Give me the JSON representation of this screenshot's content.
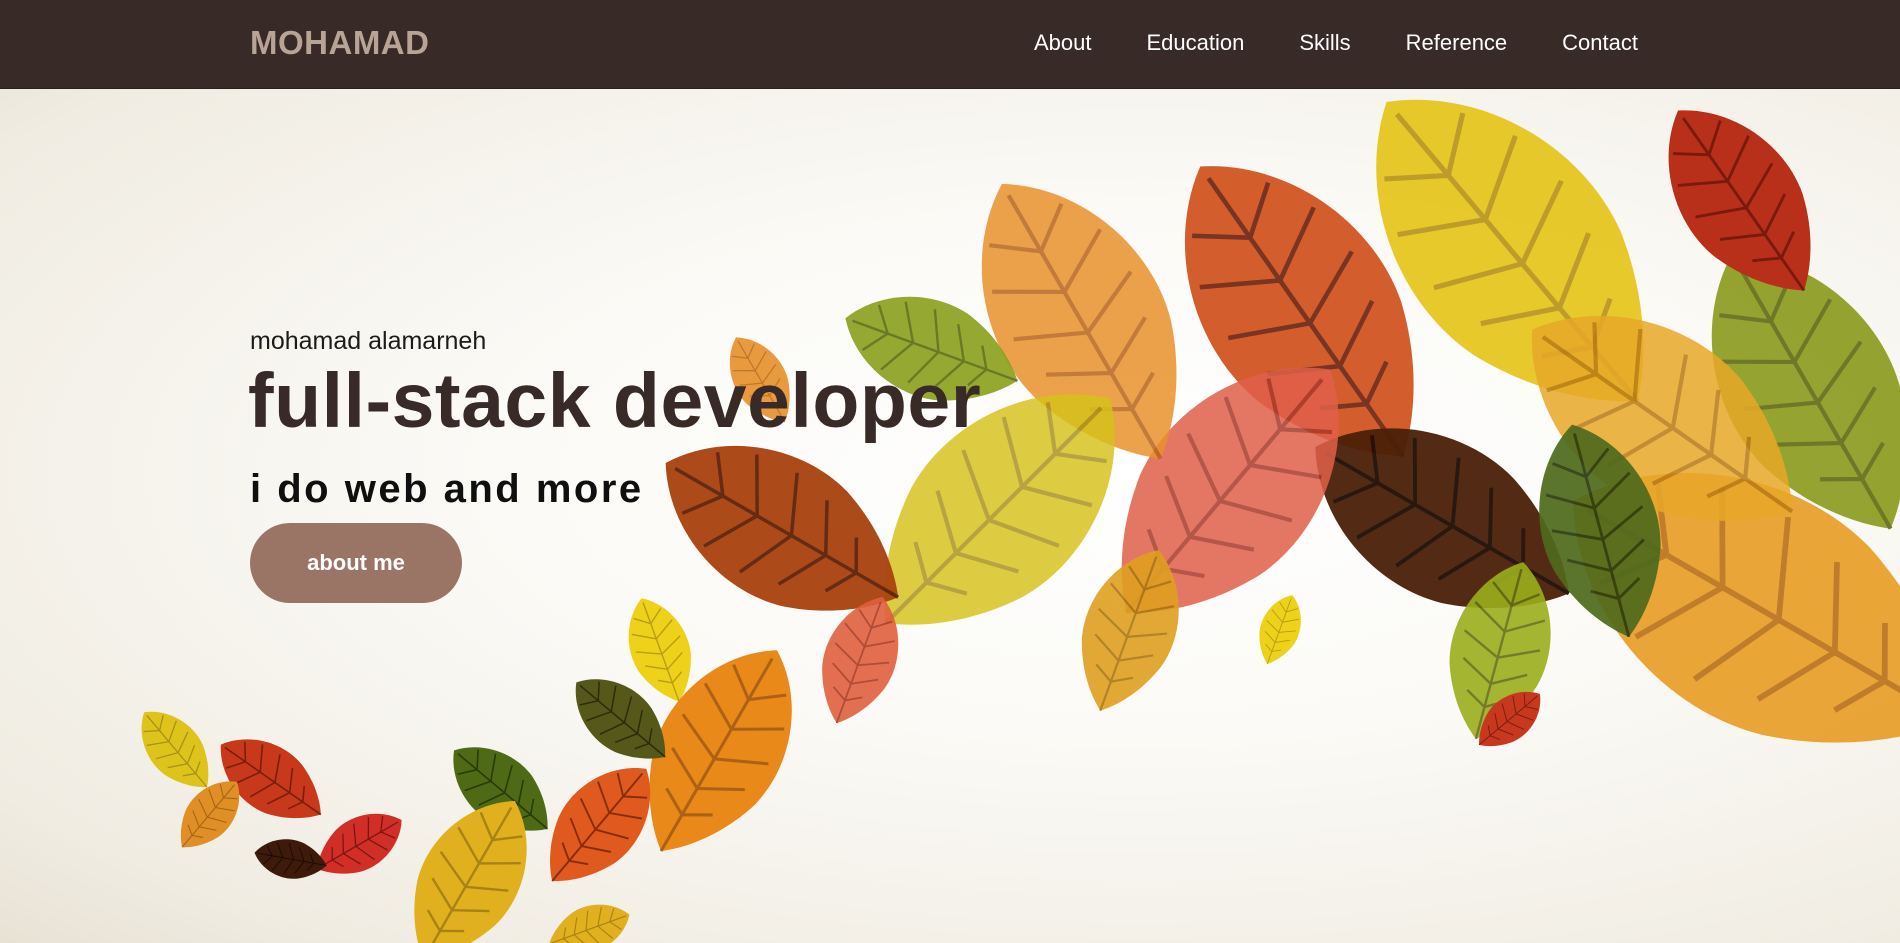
{
  "nav": {
    "brand": "MOHAMAD",
    "links": [
      {
        "label": "About"
      },
      {
        "label": "Education"
      },
      {
        "label": "Skills"
      },
      {
        "label": "Reference"
      },
      {
        "label": "Contact"
      }
    ]
  },
  "hero": {
    "subtitle": "mohamad alamarneh",
    "headline": "full-stack developer",
    "tagline": "i do web and more",
    "cta_label": "about me",
    "background_art": "autumn-leaves-illustration"
  },
  "colors": {
    "navbar": "#382a26",
    "brand": "#b8a496",
    "headline": "#382a26",
    "button": "#9a7566"
  }
}
